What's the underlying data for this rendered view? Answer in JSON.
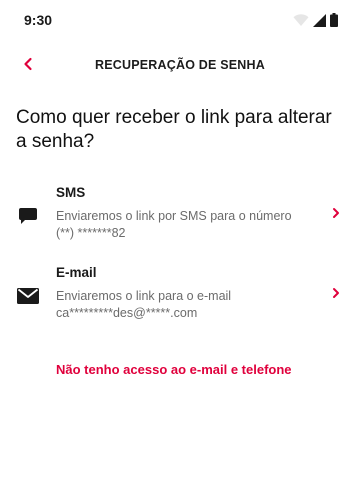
{
  "status_bar": {
    "time": "9:30"
  },
  "header": {
    "title": "RECUPERAÇÃO DE SENHA"
  },
  "question": "Como quer receber o link para alterar a senha?",
  "options": [
    {
      "title": "SMS",
      "description": "Enviaremos o link por SMS para o número (**) *******82",
      "icon": "chat-bubble-icon"
    },
    {
      "title": "E-mail",
      "description": "Enviaremos o link para o e-mail ca*********des@*****.com",
      "icon": "envelope-icon"
    }
  ],
  "no_access_link": "Não tenho acesso ao e-mail e telefone",
  "colors": {
    "accent": "#e0003c",
    "text_primary": "#1a1a1a",
    "text_secondary": "#6b6b6b",
    "background": "#ffffff"
  }
}
